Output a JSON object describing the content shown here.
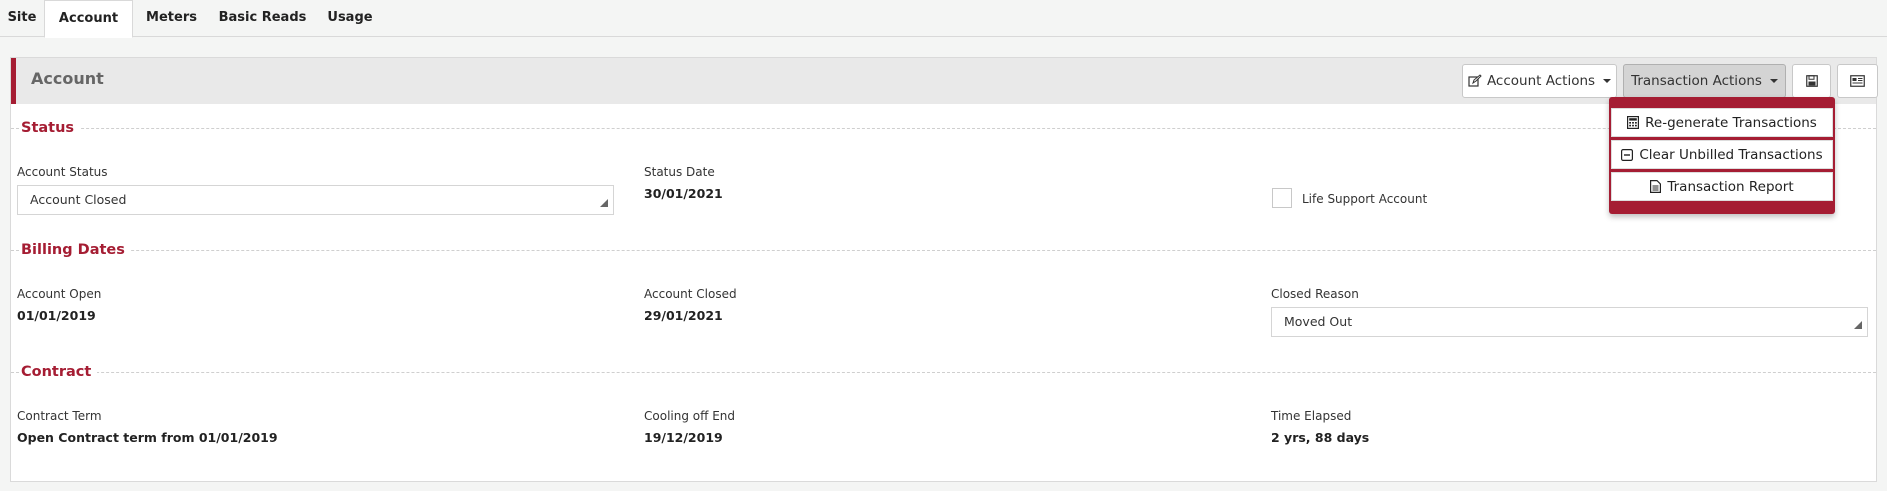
{
  "tabs": [
    {
      "label": "Site",
      "active": false
    },
    {
      "label": "Account",
      "active": true
    },
    {
      "label": "Meters",
      "active": false
    },
    {
      "label": "Basic Reads",
      "active": false
    },
    {
      "label": "Usage",
      "active": false
    }
  ],
  "panel": {
    "title": "Account",
    "buttons": {
      "account_actions": "Account Actions",
      "transaction_actions": "Transaction Actions"
    }
  },
  "dropdown": {
    "items": [
      {
        "label": "Re-generate Transactions",
        "icon": "calculator-icon"
      },
      {
        "label": "Clear Unbilled Transactions",
        "icon": "minus-square-icon"
      },
      {
        "label": "Transaction Report",
        "icon": "document-icon"
      }
    ]
  },
  "status": {
    "title": "Status",
    "account_status_label": "Account Status",
    "account_status_value": "Account Closed",
    "status_date_label": "Status Date",
    "status_date_value": "30/01/2021",
    "life_support_label": "Life Support Account",
    "life_support_checked": false
  },
  "billing": {
    "title": "Billing Dates",
    "account_open_label": "Account Open",
    "account_open_value": "01/01/2019",
    "account_closed_label": "Account Closed",
    "account_closed_value": "29/01/2021",
    "closed_reason_label": "Closed Reason",
    "closed_reason_value": "Moved Out"
  },
  "contract": {
    "title": "Contract",
    "term_label": "Contract Term",
    "term_value": "Open Contract term from 01/01/2019",
    "cooling_off_label": "Cooling off End",
    "cooling_off_value": "19/12/2019",
    "time_elapsed_label": "Time Elapsed",
    "time_elapsed_value": "2 yrs, 88 days"
  },
  "colors": {
    "accent": "#a51d33",
    "header_bg": "#e9e9e9",
    "page_bg": "#f4f5f4"
  }
}
